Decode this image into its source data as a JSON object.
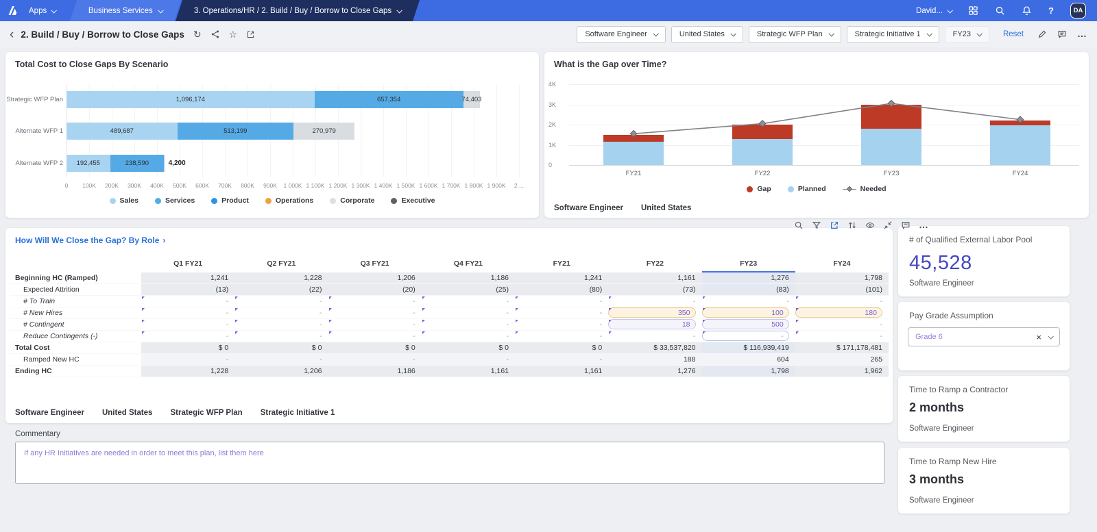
{
  "topnav": {
    "apps_label": "Apps",
    "workspace_tab": "Business Services",
    "page_tab": "3. Operations/HR / 2. Build / Buy / Borrow to Close Gaps",
    "user_label": "David...",
    "avatar_initials": "DA"
  },
  "page_header": {
    "title": "2. Build / Buy / Borrow to Close Gaps",
    "filters": [
      "Software Engineer",
      "United States",
      "Strategic WFP Plan",
      "Strategic Initiative 1",
      "FY23"
    ],
    "reset_label": "Reset"
  },
  "chart_data": [
    {
      "type": "bar",
      "orientation": "horizontal",
      "title": "Total Cost to Close Gaps By Scenario",
      "categories": [
        "Strategic WFP Plan",
        "Alternate WFP 1",
        "Alternate WFP 2"
      ],
      "series": [
        {
          "name": "Sales",
          "color": "#a9d4f1",
          "values": [
            1096174,
            489687,
            192455
          ],
          "labels": [
            "1,096,174",
            "489,687",
            "192,455"
          ]
        },
        {
          "name": "Services",
          "color": "#55aae6",
          "values": [
            657354,
            513199,
            238590
          ],
          "labels": [
            "657,354",
            "513,199",
            "238,590"
          ]
        },
        {
          "name": "Corporate",
          "color": "#d9dce1",
          "values": [
            74403,
            270979,
            4200
          ],
          "labels": [
            "74,403",
            "270,979",
            "4,200"
          ]
        }
      ],
      "xlim": [
        0,
        2000000
      ],
      "x_ticks": [
        "0",
        "100K",
        "200K",
        "300K",
        "400K",
        "500K",
        "600K",
        "700K",
        "800K",
        "900K",
        "1 000K",
        "1 100K",
        "1 200K",
        "1 300K",
        "1 400K",
        "1 500K",
        "1 600K",
        "1 700K",
        "1 800K",
        "1 900K",
        "2 ..."
      ],
      "grid": true,
      "legend_position": "bottom",
      "legend": [
        {
          "label": "Sales",
          "color": "#a9d4f1"
        },
        {
          "label": "Services",
          "color": "#55aae6"
        },
        {
          "label": "Product",
          "color": "#2e93e6"
        },
        {
          "label": "Operations",
          "color": "#f0a23c"
        },
        {
          "label": "Corporate",
          "color": "#dcdfe3"
        },
        {
          "label": "Executive",
          "color": "#5d6167"
        }
      ]
    },
    {
      "type": "bar",
      "subtype": "stacked-bars-with-line",
      "title": "What is the Gap over Time?",
      "categories": [
        "FY21",
        "FY22",
        "FY23",
        "FY24"
      ],
      "series": [
        {
          "name": "Planned",
          "type": "bar",
          "color": "#a5d2ef",
          "values": [
            1150,
            1300,
            1800,
            1950
          ]
        },
        {
          "name": "Gap",
          "type": "bar",
          "color": "#bd3a26",
          "values": [
            350,
            700,
            1200,
            250
          ]
        },
        {
          "name": "Needed",
          "type": "line",
          "color": "#85888d",
          "values": [
            1550,
            2050,
            3050,
            2250
          ]
        }
      ],
      "ylim": [
        0,
        4000
      ],
      "y_ticks": [
        "0",
        "1K",
        "2K",
        "3K",
        "4K"
      ],
      "grid": true,
      "legend_position": "bottom",
      "legend": [
        {
          "label": "Gap",
          "color": "#bd3a26",
          "marker": "circle"
        },
        {
          "label": "Planned",
          "color": "#a5d2ef",
          "marker": "circle"
        },
        {
          "label": "Needed",
          "color": "#85888d",
          "marker": "diamond"
        }
      ],
      "context": [
        "Software Engineer",
        "United States"
      ]
    }
  ],
  "grid": {
    "title": "How Will We Close the Gap? By Role",
    "link_arrow": "›",
    "columns": [
      "Q1 FY21",
      "Q2 FY21",
      "Q3 FY21",
      "Q4 FY21",
      "FY21",
      "FY22",
      "FY23",
      "FY24"
    ],
    "selected_column_index": 6,
    "rows": [
      {
        "label": "Beginning HC (Ramped)",
        "bold": true,
        "shade": "dark",
        "values": [
          "1,241",
          "1,228",
          "1,206",
          "1,186",
          "1,241",
          "1,161",
          "1,276",
          "1,798"
        ]
      },
      {
        "label": "Expected Attrition",
        "indent": true,
        "shade": "dark",
        "values": [
          "(13)",
          "(22)",
          "(20)",
          "(25)",
          "(80)",
          "(73)",
          "(83)",
          "(101)"
        ]
      },
      {
        "label": "# To Train",
        "indent": true,
        "editable": true,
        "values": [
          "-",
          "-",
          "-",
          "-",
          "-",
          "-",
          "-",
          "-"
        ]
      },
      {
        "label": "# New Hires",
        "indent": true,
        "editable": true,
        "values": [
          "-",
          "-",
          "-",
          "-",
          "-",
          "350",
          "100",
          "180"
        ],
        "pills": {
          "5": "orange",
          "6": "orange",
          "7": "orange"
        }
      },
      {
        "label": "# Contingent",
        "indent": true,
        "editable": true,
        "values": [
          "-",
          "-",
          "-",
          "-",
          "-",
          "18",
          "500",
          "-"
        ],
        "pills": {
          "5": "lavender",
          "6": "lavender"
        }
      },
      {
        "label": "Reduce Contingents (-)",
        "indent": true,
        "editable": true,
        "values": [
          "-",
          "-",
          "-",
          "-",
          "-",
          "-",
          "-",
          "-"
        ],
        "pills": {
          "6": "selected"
        }
      },
      {
        "label": "Total Cost",
        "bold": true,
        "shade": "dark",
        "values": [
          "$ 0",
          "$ 0",
          "$ 0",
          "$ 0",
          "$ 0",
          "$ 33,537,820",
          "$ 116,939,419",
          "$ 171,178,481"
        ]
      },
      {
        "label": "Ramped New HC",
        "indent": true,
        "shade": "light",
        "values": [
          "-",
          "-",
          "-",
          "-",
          "-",
          "188",
          "604",
          "265"
        ]
      },
      {
        "label": "Ending HC",
        "bold": true,
        "shade": "dark",
        "values": [
          "1,228",
          "1,206",
          "1,186",
          "1,161",
          "1,161",
          "1,276",
          "1,798",
          "1,962"
        ]
      }
    ],
    "context_tags": [
      "Software Engineer",
      "United States",
      "Strategic WFP Plan",
      "Strategic Initiative 1"
    ]
  },
  "commentary": {
    "label": "Commentary",
    "placeholder": "If any HR Initiatives are needed in order to meet this plan, list them here"
  },
  "kpis": {
    "labor_pool": {
      "title": "# of Qualified External Labor Pool",
      "value": "45,528",
      "subtitle": "Software Engineer"
    },
    "pay_grade": {
      "title": "Pay Grade Assumption",
      "value": "Grade 6"
    },
    "contractor_ramp": {
      "title": "Time to Ramp a Contractor",
      "value": "2 months",
      "subtitle": "Software Engineer"
    },
    "new_hire_ramp": {
      "title": "Time to Ramp New Hire",
      "value": "3 months",
      "subtitle": "Software Engineer"
    }
  }
}
